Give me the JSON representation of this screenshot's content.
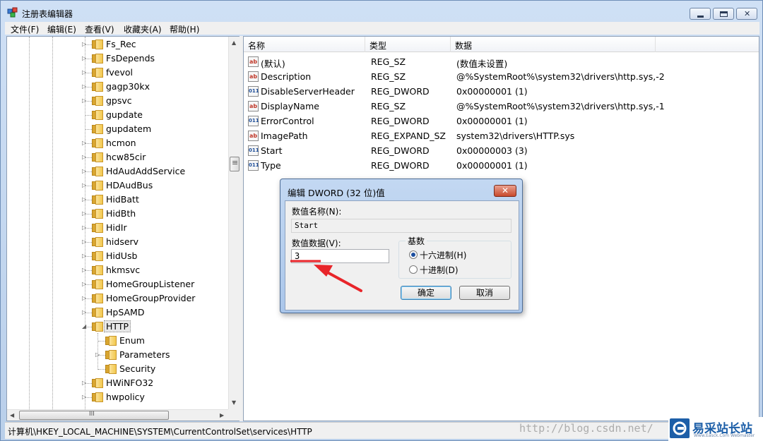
{
  "window": {
    "title": "注册表编辑器"
  },
  "menu": [
    "文件(F)",
    "编辑(E)",
    "查看(V)",
    "收藏夹(A)",
    "帮助(H)"
  ],
  "tree": {
    "items": [
      {
        "label": "Fs_Rec",
        "expander": "▷"
      },
      {
        "label": "FsDepends",
        "expander": "▷"
      },
      {
        "label": "fvevol",
        "expander": "▷"
      },
      {
        "label": "gagp30kx",
        "expander": "▷"
      },
      {
        "label": "gpsvc",
        "expander": "▷"
      },
      {
        "label": "gupdate",
        "expander": ""
      },
      {
        "label": "gupdatem",
        "expander": ""
      },
      {
        "label": "hcmon",
        "expander": "▷"
      },
      {
        "label": "hcw85cir",
        "expander": "▷"
      },
      {
        "label": "HdAudAddService",
        "expander": "▷"
      },
      {
        "label": "HDAudBus",
        "expander": "▷"
      },
      {
        "label": "HidBatt",
        "expander": "▷"
      },
      {
        "label": "HidBth",
        "expander": "▷"
      },
      {
        "label": "HidIr",
        "expander": "▷"
      },
      {
        "label": "hidserv",
        "expander": "▷"
      },
      {
        "label": "HidUsb",
        "expander": "▷"
      },
      {
        "label": "hkmsvc",
        "expander": "▷"
      },
      {
        "label": "HomeGroupListener",
        "expander": "▷"
      },
      {
        "label": "HomeGroupProvider",
        "expander": "▷"
      },
      {
        "label": "HpSAMD",
        "expander": "▷"
      },
      {
        "label": "HTTP",
        "expander": "◢"
      },
      {
        "label": "Enum",
        "expander": "",
        "child": true
      },
      {
        "label": "Parameters",
        "expander": "▷",
        "child": true
      },
      {
        "label": "Security",
        "expander": "",
        "child": true
      },
      {
        "label": "HWiNFO32",
        "expander": "▷"
      },
      {
        "label": "hwpolicy",
        "expander": "▷"
      }
    ],
    "selected_index": 20,
    "scrollbar_grip": "≡",
    "hscroll_grip": "III"
  },
  "list": {
    "headers": [
      "名称",
      "类型",
      "数据"
    ],
    "rows": [
      {
        "icon": "ab",
        "icon_name": "string-value-icon",
        "name": "(默认)",
        "type": "REG_SZ",
        "data": "(数值未设置)"
      },
      {
        "icon": "ab",
        "icon_name": "string-value-icon",
        "name": "Description",
        "type": "REG_SZ",
        "data": "@%SystemRoot%\\system32\\drivers\\http.sys,-2"
      },
      {
        "icon": "011",
        "icon_name": "dword-value-icon",
        "name": "DisableServerHeader",
        "type": "REG_DWORD",
        "data": "0x00000001 (1)"
      },
      {
        "icon": "ab",
        "icon_name": "string-value-icon",
        "name": "DisplayName",
        "type": "REG_SZ",
        "data": "@%SystemRoot%\\system32\\drivers\\http.sys,-1"
      },
      {
        "icon": "011",
        "icon_name": "dword-value-icon",
        "name": "ErrorControl",
        "type": "REG_DWORD",
        "data": "0x00000001 (1)"
      },
      {
        "icon": "ab",
        "icon_name": "string-value-icon",
        "name": "ImagePath",
        "type": "REG_EXPAND_SZ",
        "data": "system32\\drivers\\HTTP.sys"
      },
      {
        "icon": "011",
        "icon_name": "dword-value-icon",
        "name": "Start",
        "type": "REG_DWORD",
        "data": "0x00000003 (3)"
      },
      {
        "icon": "011",
        "icon_name": "dword-value-icon",
        "name": "Type",
        "type": "REG_DWORD",
        "data": "0x00000001 (1)"
      }
    ]
  },
  "dialog": {
    "title": "编辑 DWORD (32 位)值",
    "close_glyph": "✕",
    "name_label": "数值名称(N):",
    "name_value": "Start",
    "data_label": "数值数据(V):",
    "data_value": "3",
    "base_label": "基数",
    "radio_hex": "十六进制(H)",
    "radio_dec": "十进制(D)",
    "selected_base": "hex",
    "ok_label": "确定",
    "cancel_label": "取消"
  },
  "status": {
    "path": "计算机\\HKEY_LOCAL_MACHINE\\SYSTEM\\CurrentControlSet\\services\\HTTP"
  },
  "watermark": {
    "url": "http://blog.csdn.net/",
    "brand": "易采站长站",
    "brand_sub": "Www.Easck.Com  Webmaster"
  },
  "colors": {
    "annotation_red": "#e8252a",
    "accent_blue": "#1d5fa8"
  }
}
